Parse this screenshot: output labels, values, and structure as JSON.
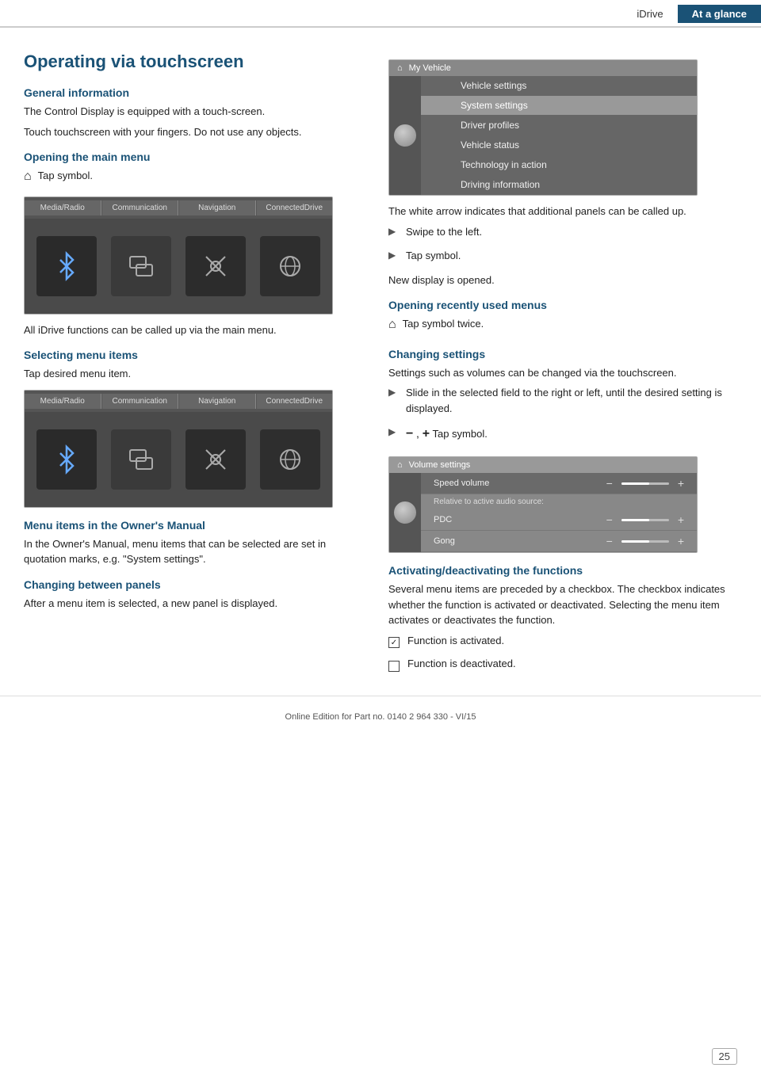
{
  "header": {
    "tab_inactive": "iDrive",
    "tab_active": "At a glance"
  },
  "page": {
    "title": "Operating via touchscreen",
    "sections": {
      "general_info": {
        "heading": "General information",
        "para1": "The Control Display is equipped with a touch-screen.",
        "para2": "Touch touchscreen with your fingers. Do not use any objects."
      },
      "opening_main_menu": {
        "heading": "Opening the main menu",
        "instruction": "Tap symbol.",
        "after_text1": "All iDrive functions can be called up via the main menu."
      },
      "selecting_menu_items": {
        "heading": "Selecting menu items",
        "instruction": "Tap desired menu item."
      },
      "menu_items_owners": {
        "heading": "Menu items in the Owner's Manual",
        "para": "In the Owner's Manual, menu items that can be selected are set in quotation marks, e.g. \"System settings\"."
      },
      "changing_between_panels": {
        "heading": "Changing between panels",
        "para": "After a menu item is selected, a new panel is displayed."
      }
    },
    "right_sections": {
      "white_arrow": {
        "intro": "The white arrow indicates that additional panels can be called up.",
        "bullet1": "Swipe to the left.",
        "bullet2": "Tap symbol.",
        "after": "New display is opened."
      },
      "opening_recently": {
        "heading": "Opening recently used menus",
        "instruction": "Tap symbol twice."
      },
      "changing_settings": {
        "heading": "Changing settings",
        "para": "Settings such as volumes can be changed via the touchscreen.",
        "bullet1": "Slide in the selected field to the right or left, until the desired setting is displayed.",
        "bullet2_prefix": "−  ,  +",
        "bullet2_suffix": "Tap symbol."
      },
      "activating": {
        "heading": "Activating/deactivating the functions",
        "para": "Several menu items are preceded by a checkbox. The checkbox indicates whether the function is activated or deactivated. Selecting the menu item activates or deactivates the function.",
        "func_activated": "Function is activated.",
        "func_deactivated": "Function is deactivated."
      }
    },
    "menu_screen": {
      "header_icon": "⌂",
      "header_label": "My Vehicle",
      "items": [
        {
          "label": "Vehicle settings",
          "selected": false
        },
        {
          "label": "System settings",
          "selected": true
        },
        {
          "label": "Driver profiles",
          "selected": false
        },
        {
          "label": "Vehicle status",
          "selected": false
        },
        {
          "label": "Technology in action",
          "selected": false
        },
        {
          "label": "Driving information",
          "selected": false
        }
      ]
    },
    "vol_screen": {
      "header_icon": "⌂",
      "header_label": "Volume settings",
      "items": [
        {
          "label": "Speed volume",
          "slider": true,
          "highlight": true
        },
        {
          "label": "Relative to active audio source:",
          "subtitle": true
        },
        {
          "label": "PDC",
          "slider": true
        },
        {
          "label": "Gong",
          "slider": true
        }
      ]
    },
    "app_tabs": [
      "Media/Radio",
      "Communication",
      "Navigation",
      "ConnectedDrive"
    ]
  },
  "footer": {
    "text": "Online Edition for Part no. 0140 2 964 330 - VI/15",
    "page_number": "25"
  }
}
